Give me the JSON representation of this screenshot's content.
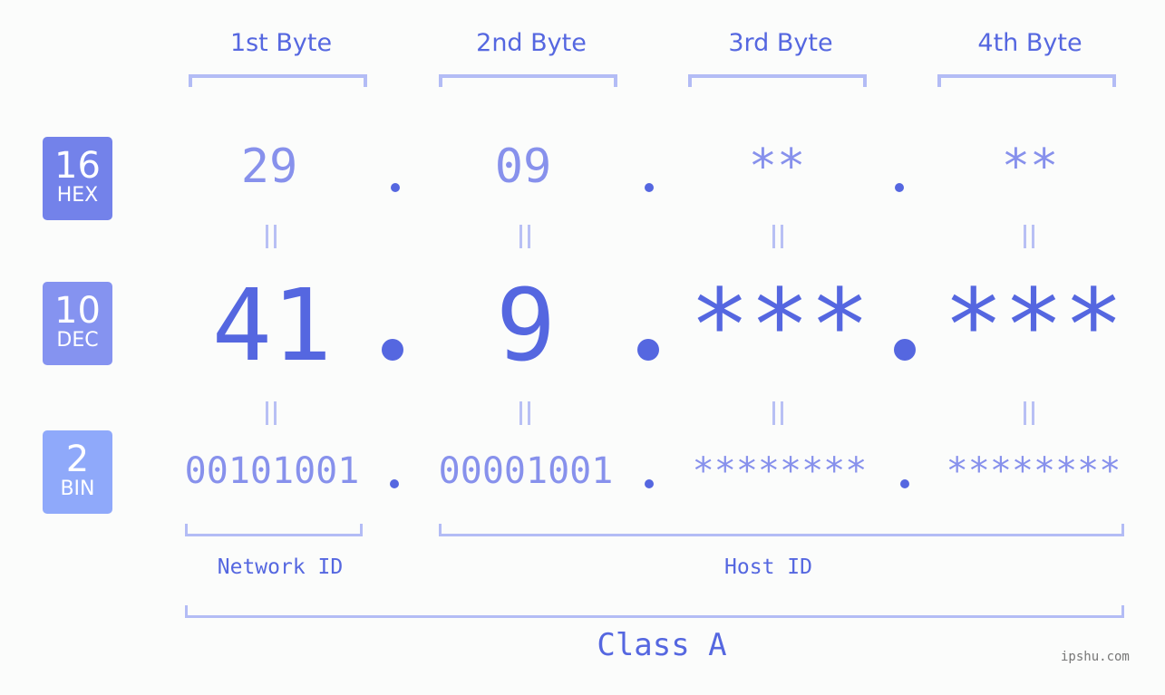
{
  "badges": [
    {
      "num": "16",
      "label": "HEX",
      "color": "#7382ea"
    },
    {
      "num": "10",
      "label": "DEC",
      "color": "#8593f0"
    },
    {
      "num": "2",
      "label": "BIN",
      "color": "#8fa9fa"
    }
  ],
  "bytes": [
    {
      "header": "1st Byte",
      "hex": "29",
      "dec": "41",
      "bin": "00101001"
    },
    {
      "header": "2nd Byte",
      "hex": "09",
      "dec": "9",
      "bin": "00001001"
    },
    {
      "header": "3rd Byte",
      "hex": "**",
      "dec": "***",
      "bin": "********"
    },
    {
      "header": "4th Byte",
      "hex": "**",
      "dec": "***",
      "bin": "********"
    }
  ],
  "network_id_label": "Network ID",
  "host_id_label": "Host ID",
  "class_label": "Class A",
  "watermark": "ipshu.com",
  "colors": {
    "accent": "#5567e0",
    "light": "#8791ec",
    "bracket": "#b3bcf5"
  }
}
